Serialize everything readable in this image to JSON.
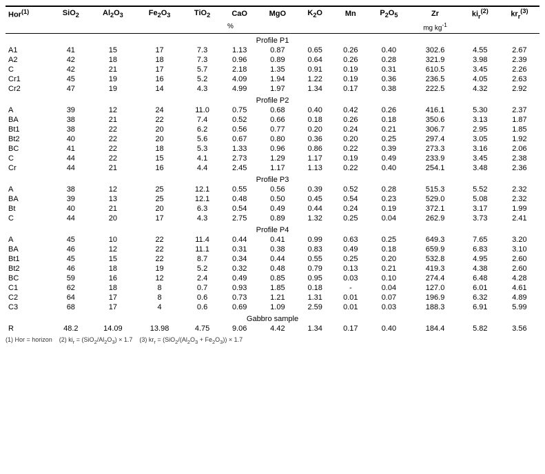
{
  "table": {
    "columns": [
      "Hor(1)",
      "SiO2",
      "Al2O3",
      "Fe2O3",
      "TiO2",
      "CaO",
      "MgO",
      "K2O",
      "Mn",
      "P2O5",
      "Zr",
      "ki(2)",
      "kr(3)"
    ],
    "col_superscripts": [
      "(1)",
      "",
      "",
      "",
      "",
      "",
      "",
      "",
      "",
      "",
      "",
      "(2)",
      "(3)"
    ],
    "units_percent": "%",
    "units_mg": "mg kg⁻¹",
    "profiles": [
      {
        "name": "Profile P1",
        "rows": [
          [
            "A1",
            "41",
            "15",
            "17",
            "7.3",
            "1.13",
            "0.87",
            "0.65",
            "0.26",
            "0.40",
            "302.6",
            "4.55",
            "2.67"
          ],
          [
            "A2",
            "42",
            "18",
            "18",
            "7.3",
            "0.96",
            "0.89",
            "0.64",
            "0.26",
            "0.28",
            "321.9",
            "3.98",
            "2.39"
          ],
          [
            "C",
            "42",
            "21",
            "17",
            "5.7",
            "2.18",
            "1.35",
            "0.91",
            "0.19",
            "0.31",
            "610.5",
            "3.45",
            "2.26"
          ],
          [
            "Cr1",
            "45",
            "19",
            "16",
            "5.2",
            "4.09",
            "1.94",
            "1.22",
            "0.19",
            "0.36",
            "236.5",
            "4.05",
            "2.63"
          ],
          [
            "Cr2",
            "47",
            "19",
            "14",
            "4.3",
            "4.99",
            "1.97",
            "1.34",
            "0.17",
            "0.38",
            "222.5",
            "4.32",
            "2.92"
          ]
        ]
      },
      {
        "name": "Profile P2",
        "rows": [
          [
            "A",
            "39",
            "12",
            "24",
            "11.0",
            "0.75",
            "0.68",
            "0.40",
            "0.42",
            "0.26",
            "416.1",
            "5.30",
            "2.37"
          ],
          [
            "BA",
            "38",
            "21",
            "22",
            "7.4",
            "0.52",
            "0.66",
            "0.18",
            "0.26",
            "0.18",
            "350.6",
            "3.13",
            "1.87"
          ],
          [
            "Bt1",
            "38",
            "22",
            "20",
            "6.2",
            "0.56",
            "0.77",
            "0.20",
            "0.24",
            "0.21",
            "306.7",
            "2.95",
            "1.85"
          ],
          [
            "Bt2",
            "40",
            "22",
            "20",
            "5.6",
            "0.67",
            "0.80",
            "0.36",
            "0.20",
            "0.25",
            "297.4",
            "3.05",
            "1.92"
          ],
          [
            "BC",
            "41",
            "22",
            "18",
            "5.3",
            "1.33",
            "0.96",
            "0.86",
            "0.22",
            "0.39",
            "273.3",
            "3.16",
            "2.06"
          ],
          [
            "C",
            "44",
            "22",
            "15",
            "4.1",
            "2.73",
            "1.29",
            "1.17",
            "0.19",
            "0.49",
            "233.9",
            "3.45",
            "2.38"
          ],
          [
            "Cr",
            "44",
            "21",
            "16",
            "4.4",
            "2.45",
            "1.17",
            "1.13",
            "0.22",
            "0.40",
            "254.1",
            "3.48",
            "2.36"
          ]
        ]
      },
      {
        "name": "Profile P3",
        "rows": [
          [
            "A",
            "38",
            "12",
            "25",
            "12.1",
            "0.55",
            "0.56",
            "0.39",
            "0.52",
            "0.28",
            "515.3",
            "5.52",
            "2.32"
          ],
          [
            "BA",
            "39",
            "13",
            "25",
            "12.1",
            "0.48",
            "0.50",
            "0.45",
            "0.54",
            "0.23",
            "529.0",
            "5.08",
            "2.32"
          ],
          [
            "Bt",
            "40",
            "21",
            "20",
            "6.3",
            "0.54",
            "0.49",
            "0.44",
            "0.24",
            "0.19",
            "372.1",
            "3.17",
            "1.99"
          ],
          [
            "C",
            "44",
            "20",
            "17",
            "4.3",
            "2.75",
            "0.89",
            "1.32",
            "0.25",
            "0.04",
            "262.9",
            "3.73",
            "2.41"
          ]
        ]
      },
      {
        "name": "Profile P4",
        "rows": [
          [
            "A",
            "45",
            "10",
            "22",
            "11.4",
            "0.44",
            "0.41",
            "0.99",
            "0.63",
            "0.25",
            "649.3",
            "7.65",
            "3.20"
          ],
          [
            "BA",
            "46",
            "12",
            "22",
            "11.1",
            "0.31",
            "0.38",
            "0.83",
            "0.49",
            "0.18",
            "659.9",
            "6.83",
            "3.10"
          ],
          [
            "Bt1",
            "45",
            "15",
            "22",
            "8.7",
            "0.34",
            "0.44",
            "0.55",
            "0.25",
            "0.20",
            "532.8",
            "4.95",
            "2.60"
          ],
          [
            "Bt2",
            "46",
            "18",
            "19",
            "5.2",
            "0.32",
            "0.48",
            "0.79",
            "0.13",
            "0.21",
            "419.3",
            "4.38",
            "2.60"
          ],
          [
            "BC",
            "59",
            "16",
            "12",
            "2.4",
            "0.49",
            "0.85",
            "0.95",
            "0.03",
            "0.10",
            "274.4",
            "6.48",
            "4.28"
          ],
          [
            "C1",
            "62",
            "18",
            "8",
            "0.7",
            "0.93",
            "1.85",
            "0.18",
            "-",
            "0.04",
            "127.0",
            "6.01",
            "4.61"
          ],
          [
            "C2",
            "64",
            "17",
            "8",
            "0.6",
            "0.73",
            "1.21",
            "1.31",
            "0.01",
            "0.07",
            "196.9",
            "6.32",
            "4.89"
          ],
          [
            "C3",
            "68",
            "17",
            "4",
            "0.6",
            "0.69",
            "1.09",
            "2.59",
            "0.01",
            "0.03",
            "188.3",
            "6.91",
            "5.99"
          ]
        ]
      }
    ],
    "gabbro": {
      "name": "Gabbro sample",
      "row": [
        "R",
        "48.2",
        "14.09",
        "13.98",
        "4.75",
        "9.06",
        "4.42",
        "1.34",
        "0.17",
        "0.40",
        "184.4",
        "5.82",
        "3.56"
      ]
    },
    "footnotes": [
      "(1) Hor = horizon",
      "(2) ki = (SiO₂/Al₂O₃) × 1.7",
      "(3) kr = (SiO₂/(Al₂O₃ + Fe₂O₃)) × 1.7"
    ]
  }
}
